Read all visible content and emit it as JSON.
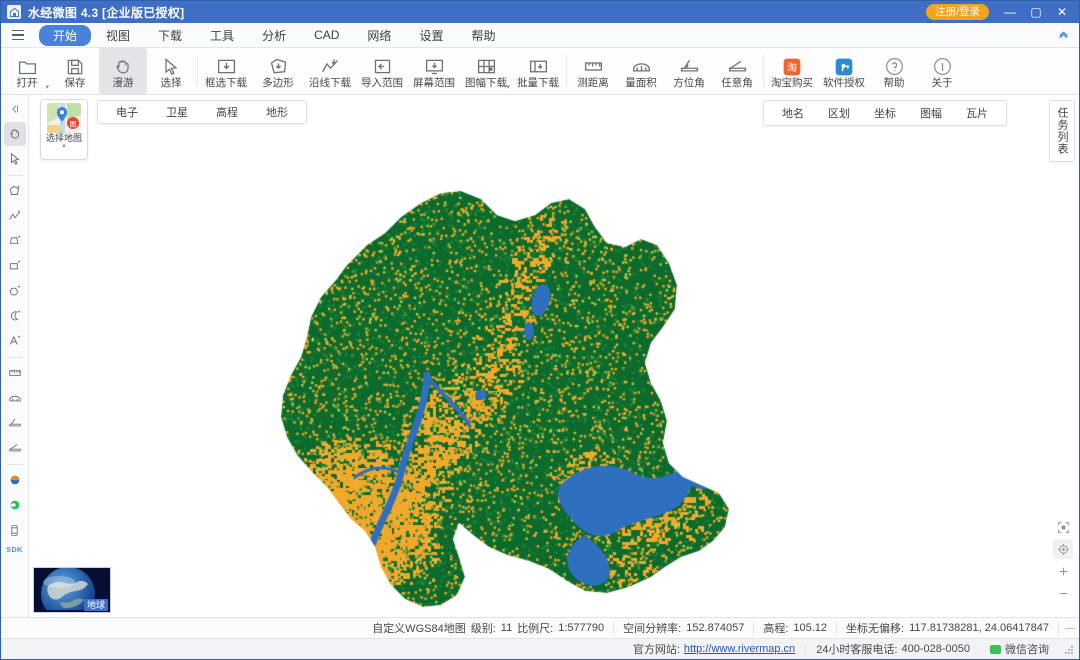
{
  "window": {
    "title": "水经微图 4.3 [企业版已授权]",
    "app_icon": "map-house-icon",
    "login_label": "注册/登录",
    "minimize": "—",
    "maximize": "▢",
    "close": "✕"
  },
  "menubar": {
    "hamburger_icon": "hamburger-menu-icon",
    "collapse_icon": "chevron-double-up-icon",
    "items": [
      {
        "label": "开始",
        "active": true
      },
      {
        "label": "视图",
        "active": false
      },
      {
        "label": "下载",
        "active": false
      },
      {
        "label": "工具",
        "active": false
      },
      {
        "label": "分析",
        "active": false
      },
      {
        "label": "CAD",
        "active": false
      },
      {
        "label": "网络",
        "active": false
      },
      {
        "label": "设置",
        "active": false
      },
      {
        "label": "帮助",
        "active": false
      }
    ]
  },
  "ribbon": {
    "items": [
      {
        "label": "打开",
        "icon": "folder-open-icon",
        "caret": true,
        "selected": false
      },
      {
        "label": "保存",
        "icon": "floppy-save-icon",
        "caret": false,
        "selected": false
      },
      {
        "label": "漫游",
        "icon": "hand-pan-icon",
        "caret": false,
        "selected": true
      },
      {
        "label": "选择",
        "icon": "cursor-arrow-icon",
        "caret": false,
        "selected": false
      },
      {
        "label": "框选下载",
        "icon": "rect-download-icon",
        "caret": false,
        "selected": false
      },
      {
        "label": "多边形",
        "icon": "polygon-download-icon",
        "caret": false,
        "selected": false
      },
      {
        "label": "沿线下载",
        "icon": "polyline-download-icon",
        "caret": false,
        "selected": false
      },
      {
        "label": "导入范围",
        "icon": "import-range-icon",
        "caret": false,
        "selected": false
      },
      {
        "label": "屏幕范围",
        "icon": "screen-range-icon",
        "caret": false,
        "selected": false
      },
      {
        "label": "图幅下载",
        "icon": "sheet-download-icon",
        "caret": true,
        "selected": false
      },
      {
        "label": "批量下载",
        "icon": "batch-download-icon",
        "caret": false,
        "selected": false
      },
      {
        "label": "测距离",
        "icon": "measure-distance-icon",
        "caret": false,
        "selected": false
      },
      {
        "label": "量面积",
        "icon": "measure-area-icon",
        "caret": false,
        "selected": false
      },
      {
        "label": "方位角",
        "icon": "azimuth-icon",
        "caret": false,
        "selected": false
      },
      {
        "label": "任意角",
        "icon": "free-angle-icon",
        "caret": false,
        "selected": false
      },
      {
        "label": "淘宝购买",
        "icon": "taobao-buy-icon",
        "caret": false,
        "selected": false
      },
      {
        "label": "软件授权",
        "icon": "license-key-icon",
        "caret": false,
        "selected": false
      },
      {
        "label": "帮助",
        "icon": "help-circle-icon",
        "caret": false,
        "selected": false
      },
      {
        "label": "关于",
        "icon": "info-circle-icon",
        "caret": false,
        "selected": false
      }
    ]
  },
  "tool_rail": {
    "items": [
      {
        "icon": "collapse-rail-icon",
        "selected": false
      },
      {
        "icon": "hand-pan-icon",
        "selected": true
      },
      {
        "icon": "cursor-arrow-icon",
        "selected": false
      },
      {
        "icon": "polygon-add-icon",
        "selected": false
      },
      {
        "icon": "polyline-add-icon",
        "selected": false
      },
      {
        "icon": "shape-add-icon",
        "selected": false
      },
      {
        "icon": "rectangle-add-icon",
        "selected": false
      },
      {
        "icon": "circle-add-icon",
        "selected": false
      },
      {
        "icon": "arc-add-icon",
        "selected": false
      },
      {
        "icon": "text-add-icon",
        "selected": false
      },
      {
        "icon": "measure-distance-icon",
        "selected": false
      },
      {
        "icon": "measure-area-icon",
        "selected": false
      },
      {
        "icon": "azimuth-icon",
        "selected": false
      },
      {
        "icon": "free-angle-icon",
        "selected": false
      },
      {
        "icon": "earth-globe-icon",
        "selected": false
      },
      {
        "icon": "wechat-green-icon",
        "selected": false
      },
      {
        "icon": "mobile-device-icon",
        "selected": false
      }
    ],
    "sdk_label": "SDK"
  },
  "map_panel": {
    "selector": {
      "caption": "选择地图",
      "icon": "map-pin-thumbnail-icon",
      "dropdown_icon": "chevron-down-icon"
    },
    "layer_tabs": [
      {
        "label": "电子",
        "active": false
      },
      {
        "label": "卫星",
        "active": false
      },
      {
        "label": "高程",
        "active": false
      },
      {
        "label": "地形",
        "active": false
      }
    ],
    "right_tabs": [
      {
        "label": "地名"
      },
      {
        "label": "区划"
      },
      {
        "label": "坐标"
      },
      {
        "label": "图幅"
      },
      {
        "label": "瓦片"
      }
    ],
    "task_tab": "任务列表",
    "controls": [
      {
        "icon": "fit-extent-icon",
        "highlight": false
      },
      {
        "icon": "locate-crosshair-icon",
        "highlight": true
      },
      {
        "icon": "zoom-in-icon",
        "highlight": false
      },
      {
        "icon": "zoom-out-icon",
        "highlight": false
      }
    ],
    "globe": {
      "label": "地球",
      "icon": "earth-globe-thumbnail"
    },
    "colors": {
      "vegetation": "#0c6b2c",
      "cropland": "#f4a82b",
      "water": "#2f6fc0",
      "background": "#ffffff"
    }
  },
  "status_bar": {
    "map_name": "自定义WGS84地图",
    "level_label": "级别:",
    "level_value": "11",
    "scale_label": "比例尺:",
    "scale_value": "1:577790",
    "resolution_label": "空间分辨率:",
    "resolution_value": "152.874057",
    "elevation_label": "高程:",
    "elevation_value": "105.12",
    "coord_label": "坐标无偏移:",
    "coord_value": "117.81738281, 24.06417847",
    "grip_icon": "resize-grip-icon"
  },
  "bottom_bar": {
    "site_label": "官方网站:",
    "site_url": "http://www.rivermap.cn",
    "phone_label": "24小时客服电话:",
    "phone_value": "400-028-0050",
    "wechat_icon": "wechat-icon",
    "wechat_label": "微信咨询"
  }
}
